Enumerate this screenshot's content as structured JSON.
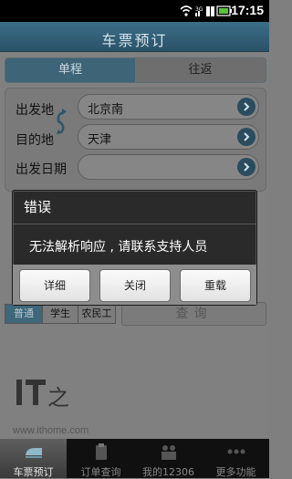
{
  "status_bar": {
    "time": "17:15"
  },
  "header": {
    "title": "车票预订"
  },
  "tabs": [
    {
      "label": "单程"
    },
    {
      "label": "往返"
    }
  ],
  "form": {
    "from_label": "出发地",
    "to_label": "目的地",
    "date_label": "出发日期",
    "from_value": "北京南",
    "to_value": "天津",
    "date_value": ""
  },
  "passenger_types": [
    {
      "label": "普通"
    },
    {
      "label": "学生"
    },
    {
      "label": "农民工"
    }
  ],
  "query_button": {
    "label": "查询"
  },
  "watermark": {
    "logo": "IT之家",
    "url": "www.ithome.com"
  },
  "dialog": {
    "title": "错误",
    "message": "无法解析响应 , 请联系支持人员",
    "buttons": [
      {
        "label": "详细"
      },
      {
        "label": "关闭"
      },
      {
        "label": "重载"
      }
    ]
  },
  "bottom_nav": [
    {
      "label": "车票预订",
      "icon": "train-icon"
    },
    {
      "label": "订单查询",
      "icon": "clipboard-icon"
    },
    {
      "label": "我的12306",
      "icon": "people-icon"
    },
    {
      "label": "更多功能",
      "icon": "more-dots-icon"
    }
  ]
}
